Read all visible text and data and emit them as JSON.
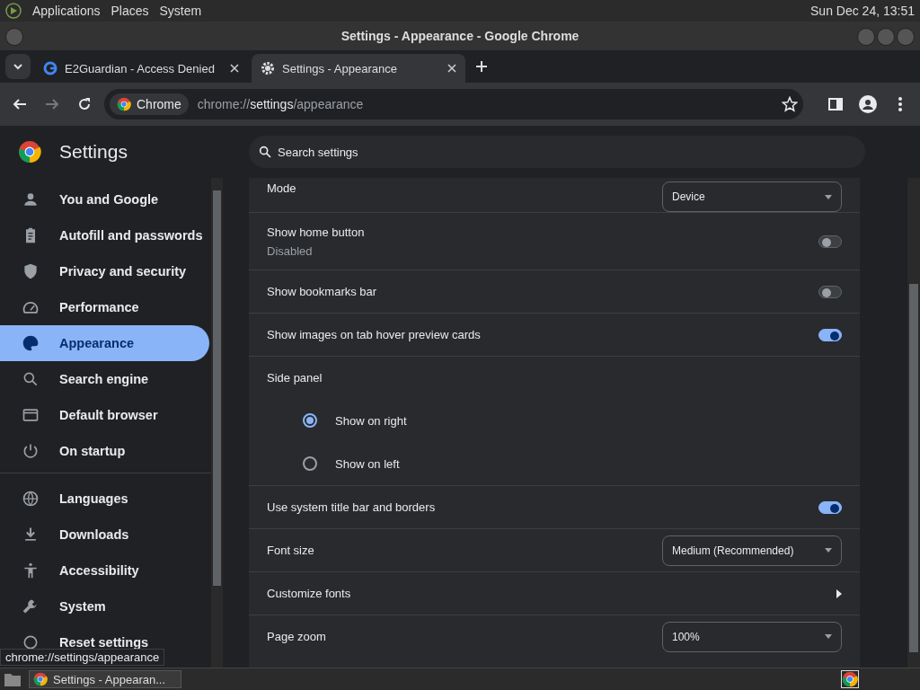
{
  "top_panel": {
    "menus": [
      "Applications",
      "Places",
      "System"
    ],
    "clock": "Sun Dec 24, 13:51"
  },
  "window": {
    "title": "Settings - Appearance - Google Chrome"
  },
  "tabs": [
    {
      "label": "E2Guardian - Access Denied",
      "selected": false
    },
    {
      "label": "Settings - Appearance",
      "selected": true
    }
  ],
  "toolbar": {
    "site_chip": "Chrome",
    "url_scheme": "chrome://",
    "url_host": "settings",
    "url_path": "/appearance"
  },
  "settings": {
    "title": "Settings",
    "search": {
      "placeholder": "Search settings"
    }
  },
  "sidebar": {
    "sections": [
      {
        "items": [
          {
            "label": "You and Google",
            "selected": false
          },
          {
            "label": "Autofill and passwords",
            "selected": false
          },
          {
            "label": "Privacy and security",
            "selected": false
          },
          {
            "label": "Performance",
            "selected": false
          },
          {
            "label": "Appearance",
            "selected": true
          },
          {
            "label": "Search engine",
            "selected": false
          },
          {
            "label": "Default browser",
            "selected": false
          },
          {
            "label": "On startup",
            "selected": false
          }
        ]
      },
      {
        "items": [
          {
            "label": "Languages",
            "selected": false
          },
          {
            "label": "Downloads",
            "selected": false
          },
          {
            "label": "Accessibility",
            "selected": false
          },
          {
            "label": "System",
            "selected": false
          },
          {
            "label": "Reset settings",
            "selected": false
          }
        ]
      }
    ]
  },
  "rows": [
    {
      "kind": "select",
      "label": "Mode",
      "value": "Device"
    },
    {
      "kind": "toggle",
      "label": "Show home button",
      "sublabel": "Disabled",
      "on": false
    },
    {
      "kind": "toggle",
      "label": "Show bookmarks bar",
      "on": false
    },
    {
      "kind": "toggle",
      "label": "Show images on tab hover preview cards",
      "on": true
    },
    {
      "kind": "heading",
      "label": "Side panel"
    },
    {
      "kind": "radio",
      "label": "Show on right",
      "selected": true
    },
    {
      "kind": "radio",
      "label": "Show on left",
      "selected": false
    },
    {
      "kind": "toggle",
      "label": "Use system title bar and borders",
      "on": true
    },
    {
      "kind": "select",
      "label": "Font size",
      "value": "Medium (Recommended)"
    },
    {
      "kind": "link",
      "label": "Customize fonts"
    },
    {
      "kind": "select",
      "label": "Page zoom",
      "value": "100%"
    }
  ],
  "status_url": "chrome://settings/appearance",
  "taskbar": {
    "windows": [
      {
        "label": "Settings - Appearan...",
        "selected": true
      }
    ]
  }
}
